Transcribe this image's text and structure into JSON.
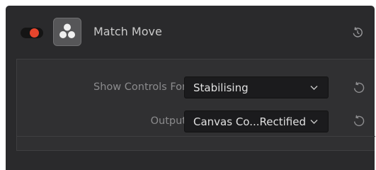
{
  "panel": {
    "title": "Match Move",
    "toggle": {
      "state": "on",
      "color": "#e5452d"
    },
    "icon": "resolve-logo-icon",
    "reset_icon": "reset-icon"
  },
  "controls": {
    "show_controls_for": {
      "label": "Show Controls For",
      "value": "Stabilising",
      "icon": "chevron-down-icon"
    },
    "output": {
      "label": "Output",
      "value": "Canvas Co...Rectified",
      "icon": "chevron-down-icon"
    }
  }
}
